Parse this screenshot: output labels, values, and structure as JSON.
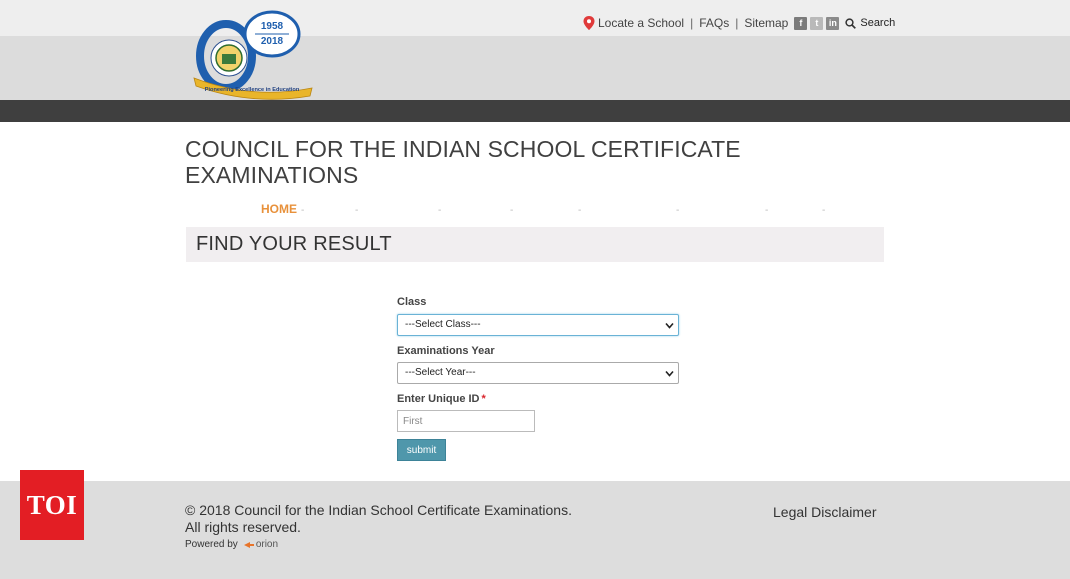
{
  "header": {
    "logo": {
      "year_start": "1958",
      "year_end": "2018",
      "anniversary": "60",
      "tagline": "Pioneering Excellence in Education"
    },
    "links": {
      "locate": "Locate a School",
      "faqs": "FAQs",
      "sitemap": "Sitemap",
      "search": "Search",
      "separator": "|"
    },
    "social": {
      "facebook": "f",
      "twitter": "t",
      "linkedin": "in"
    }
  },
  "main": {
    "org_title_line1": "COUNCIL FOR THE INDIAN SCHOOL CERTIFICATE",
    "org_title_line2": "EXAMINATIONS",
    "nav": {
      "home": "HOME",
      "dash": "-"
    },
    "section_title": "FIND YOUR RESULT"
  },
  "form": {
    "class_label": "Class",
    "class_value": "---Select Class---",
    "year_label": "Examinations Year",
    "year_value": "---Select Year---",
    "uid_label": "Enter Unique ID",
    "uid_required": "*",
    "uid_placeholder": "First",
    "submit_label": "submit"
  },
  "footer": {
    "copyright_line1": "© 2018 Council for the Indian School Certificate Examinations.",
    "copyright_line2": "All rights reserved.",
    "powered_by": "Powered by",
    "powered_brand": "orion",
    "legal": "Legal Disclaimer"
  },
  "watermark": {
    "text": "TOI"
  },
  "colors": {
    "accent_orange": "#e8913b",
    "submit_blue": "#4f97ab",
    "header_dark": "#3f3f3f",
    "toi_red": "#e31e24",
    "required_red": "#d9242c"
  }
}
